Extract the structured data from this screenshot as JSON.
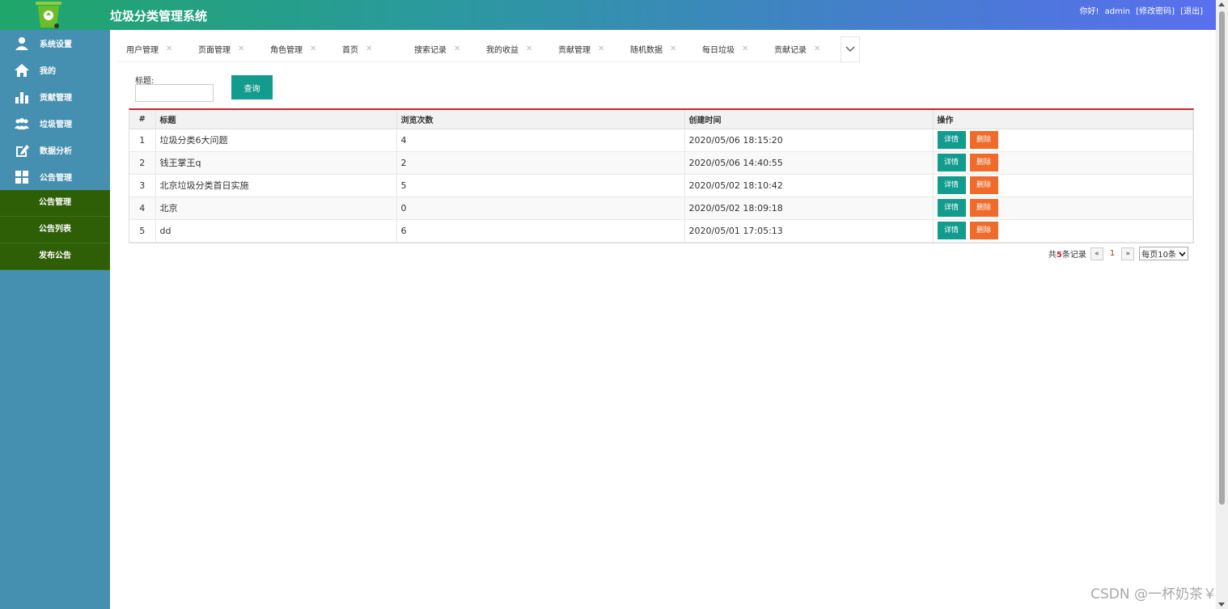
{
  "header": {
    "title": "垃圾分类管理系统",
    "greeting": "你好!",
    "username": "admin",
    "change_password": "[修改密码]",
    "logout": "[退出]"
  },
  "sidebar": {
    "items": [
      {
        "label": "系统设置",
        "icon": "user-icon"
      },
      {
        "label": "我的",
        "icon": "home-icon"
      },
      {
        "label": "贡献管理",
        "icon": "bar-chart-icon"
      },
      {
        "label": "垃圾管理",
        "icon": "group-icon"
      },
      {
        "label": "数据分析",
        "icon": "edit-icon"
      },
      {
        "label": "公告管理",
        "icon": "grid-icon"
      }
    ],
    "sub_items": [
      "公告管理",
      "公告列表",
      "发布公告"
    ]
  },
  "tabs": [
    "用户管理",
    "页面管理",
    "角色管理",
    "首页",
    "搜索记录",
    "我的收益",
    "贡献管理",
    "随机数据",
    "每日垃圾",
    "贡献记录"
  ],
  "search": {
    "label": "标题:",
    "value": "",
    "button": "查询"
  },
  "table": {
    "headers": [
      "#",
      "标题",
      "浏览次数",
      "创建时间",
      "操作"
    ],
    "rows": [
      {
        "num": "1",
        "title": "垃圾分类6大问题",
        "views": "4",
        "created": "2020/05/06 18:15:20"
      },
      {
        "num": "2",
        "title": "钱王掌王q",
        "views": "2",
        "created": "2020/05/06 14:40:55"
      },
      {
        "num": "3",
        "title": "北京垃圾分类首日实施",
        "views": "5",
        "created": "2020/05/02 18:10:42"
      },
      {
        "num": "4",
        "title": "北京",
        "views": "0",
        "created": "2020/05/02 18:09:18"
      },
      {
        "num": "5",
        "title": "dd",
        "views": "6",
        "created": "2020/05/01 17:05:13"
      }
    ],
    "detail_label": "详情",
    "delete_label": "删除"
  },
  "pager": {
    "prefix": "共",
    "total": "5",
    "suffix": "条记录",
    "prev": "«",
    "current": "1",
    "next": "»",
    "page_size": "每页10条"
  },
  "watermark": "CSDN @一杯奶茶￥",
  "colors": {
    "primary": "#129c8e",
    "danger": "#f06a2a",
    "sidebar": "#4590b0",
    "submenu": "#2e5f06",
    "accent": "#c0282e"
  }
}
